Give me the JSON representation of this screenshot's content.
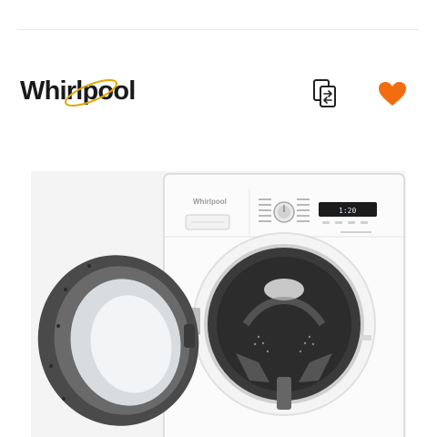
{
  "header": {
    "brand_name": "Whirlpool",
    "logo_icon": "whirlpool-logo",
    "compare_icon": "compare-icon",
    "favorite_icon": "heart-icon"
  },
  "product": {
    "image_icon": "washing-machine-image",
    "brand_badge": "Whirlpool",
    "display_readout": "1:20",
    "colors": {
      "accent": "#f36c0f",
      "body": "#fbfbfb",
      "door_ring": "#4a4a4a",
      "display": "#1c1c1c"
    }
  }
}
